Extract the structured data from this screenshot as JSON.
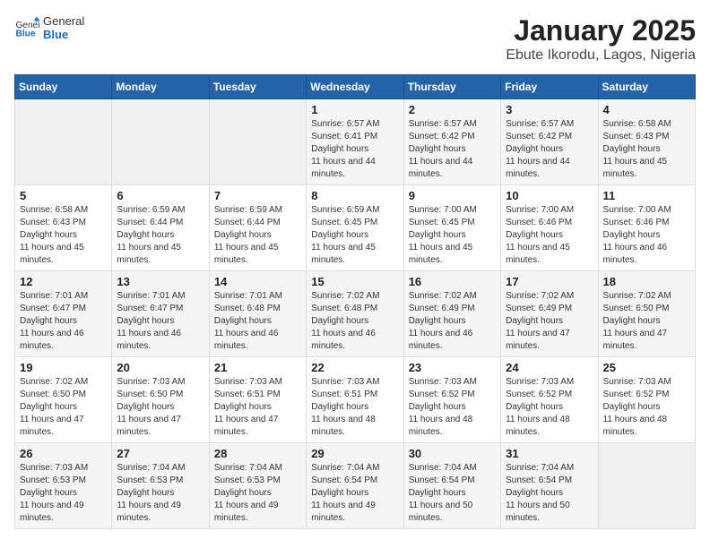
{
  "logo": {
    "general": "General",
    "blue": "Blue"
  },
  "title": "January 2025",
  "subtitle": "Ebute Ikorodu, Lagos, Nigeria",
  "days_of_week": [
    "Sunday",
    "Monday",
    "Tuesday",
    "Wednesday",
    "Thursday",
    "Friday",
    "Saturday"
  ],
  "weeks": [
    [
      {
        "day": "",
        "empty": true
      },
      {
        "day": "",
        "empty": true
      },
      {
        "day": "",
        "empty": true
      },
      {
        "day": "1",
        "sunrise": "6:57 AM",
        "sunset": "6:41 PM",
        "daylight": "11 hours and 44 minutes."
      },
      {
        "day": "2",
        "sunrise": "6:57 AM",
        "sunset": "6:42 PM",
        "daylight": "11 hours and 44 minutes."
      },
      {
        "day": "3",
        "sunrise": "6:57 AM",
        "sunset": "6:42 PM",
        "daylight": "11 hours and 44 minutes."
      },
      {
        "day": "4",
        "sunrise": "6:58 AM",
        "sunset": "6:43 PM",
        "daylight": "11 hours and 45 minutes."
      }
    ],
    [
      {
        "day": "5",
        "sunrise": "6:58 AM",
        "sunset": "6:43 PM",
        "daylight": "11 hours and 45 minutes."
      },
      {
        "day": "6",
        "sunrise": "6:59 AM",
        "sunset": "6:44 PM",
        "daylight": "11 hours and 45 minutes."
      },
      {
        "day": "7",
        "sunrise": "6:59 AM",
        "sunset": "6:44 PM",
        "daylight": "11 hours and 45 minutes."
      },
      {
        "day": "8",
        "sunrise": "6:59 AM",
        "sunset": "6:45 PM",
        "daylight": "11 hours and 45 minutes."
      },
      {
        "day": "9",
        "sunrise": "7:00 AM",
        "sunset": "6:45 PM",
        "daylight": "11 hours and 45 minutes."
      },
      {
        "day": "10",
        "sunrise": "7:00 AM",
        "sunset": "6:46 PM",
        "daylight": "11 hours and 45 minutes."
      },
      {
        "day": "11",
        "sunrise": "7:00 AM",
        "sunset": "6:46 PM",
        "daylight": "11 hours and 46 minutes."
      }
    ],
    [
      {
        "day": "12",
        "sunrise": "7:01 AM",
        "sunset": "6:47 PM",
        "daylight": "11 hours and 46 minutes."
      },
      {
        "day": "13",
        "sunrise": "7:01 AM",
        "sunset": "6:47 PM",
        "daylight": "11 hours and 46 minutes."
      },
      {
        "day": "14",
        "sunrise": "7:01 AM",
        "sunset": "6:48 PM",
        "daylight": "11 hours and 46 minutes."
      },
      {
        "day": "15",
        "sunrise": "7:02 AM",
        "sunset": "6:48 PM",
        "daylight": "11 hours and 46 minutes."
      },
      {
        "day": "16",
        "sunrise": "7:02 AM",
        "sunset": "6:49 PM",
        "daylight": "11 hours and 46 minutes."
      },
      {
        "day": "17",
        "sunrise": "7:02 AM",
        "sunset": "6:49 PM",
        "daylight": "11 hours and 47 minutes."
      },
      {
        "day": "18",
        "sunrise": "7:02 AM",
        "sunset": "6:50 PM",
        "daylight": "11 hours and 47 minutes."
      }
    ],
    [
      {
        "day": "19",
        "sunrise": "7:02 AM",
        "sunset": "6:50 PM",
        "daylight": "11 hours and 47 minutes."
      },
      {
        "day": "20",
        "sunrise": "7:03 AM",
        "sunset": "6:50 PM",
        "daylight": "11 hours and 47 minutes."
      },
      {
        "day": "21",
        "sunrise": "7:03 AM",
        "sunset": "6:51 PM",
        "daylight": "11 hours and 47 minutes."
      },
      {
        "day": "22",
        "sunrise": "7:03 AM",
        "sunset": "6:51 PM",
        "daylight": "11 hours and 48 minutes."
      },
      {
        "day": "23",
        "sunrise": "7:03 AM",
        "sunset": "6:52 PM",
        "daylight": "11 hours and 48 minutes."
      },
      {
        "day": "24",
        "sunrise": "7:03 AM",
        "sunset": "6:52 PM",
        "daylight": "11 hours and 48 minutes."
      },
      {
        "day": "25",
        "sunrise": "7:03 AM",
        "sunset": "6:52 PM",
        "daylight": "11 hours and 48 minutes."
      }
    ],
    [
      {
        "day": "26",
        "sunrise": "7:03 AM",
        "sunset": "6:53 PM",
        "daylight": "11 hours and 49 minutes."
      },
      {
        "day": "27",
        "sunrise": "7:04 AM",
        "sunset": "6:53 PM",
        "daylight": "11 hours and 49 minutes."
      },
      {
        "day": "28",
        "sunrise": "7:04 AM",
        "sunset": "6:53 PM",
        "daylight": "11 hours and 49 minutes."
      },
      {
        "day": "29",
        "sunrise": "7:04 AM",
        "sunset": "6:54 PM",
        "daylight": "11 hours and 49 minutes."
      },
      {
        "day": "30",
        "sunrise": "7:04 AM",
        "sunset": "6:54 PM",
        "daylight": "11 hours and 50 minutes."
      },
      {
        "day": "31",
        "sunrise": "7:04 AM",
        "sunset": "6:54 PM",
        "daylight": "11 hours and 50 minutes."
      },
      {
        "day": "",
        "empty": true
      }
    ]
  ]
}
